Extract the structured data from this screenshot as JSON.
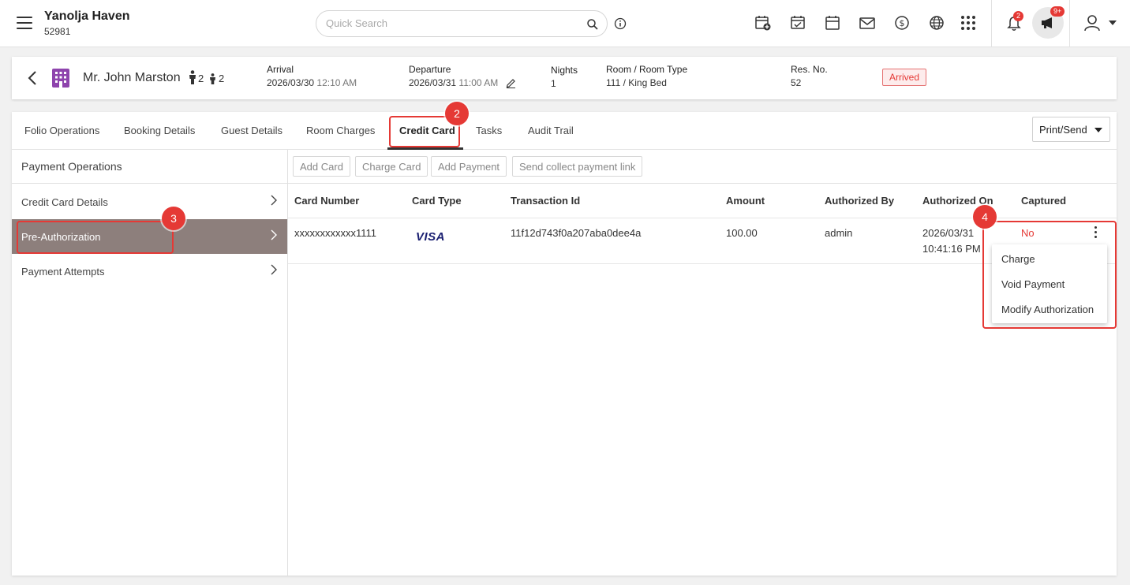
{
  "topbar": {
    "property_name": "Yanolja Haven",
    "property_code": "52981",
    "search_placeholder": "Quick Search",
    "notification_count": "2",
    "announcement_count": "9+",
    "icons": [
      "new-reservation-icon",
      "checklist-icon",
      "calendar-icon",
      "mail-icon",
      "dollar-icon",
      "globe-icon",
      "apps-grid-icon",
      "bell-icon",
      "megaphone-icon",
      "user-icon"
    ]
  },
  "reservation": {
    "guest_name": "Mr. John Marston",
    "adults": "2",
    "children": "2",
    "arrival_label": "Arrival",
    "arrival_date": "2026/03/30",
    "arrival_time": "12:10 AM",
    "departure_label": "Departure",
    "departure_date": "2026/03/31",
    "departure_time": "11:00 AM",
    "nights_label": "Nights",
    "nights": "1",
    "room_label": "Room / Room Type",
    "room_value": "111 / King Bed",
    "resno_label": "Res. No.",
    "resno": "52",
    "status": "Arrived"
  },
  "tabs": [
    "Folio Operations",
    "Booking Details",
    "Guest Details",
    "Room Charges",
    "Credit Card",
    "Tasks",
    "Audit Trail"
  ],
  "active_tab": "Credit Card",
  "print_send_label": "Print/Send",
  "left_nav": {
    "title": "Payment Operations",
    "items": [
      "Credit Card Details",
      "Pre-Authorization",
      "Payment Attempts"
    ],
    "active": "Pre-Authorization"
  },
  "toolbar": {
    "buttons": [
      "Add Card",
      "Charge Card",
      "Add Payment",
      "Send collect payment link"
    ]
  },
  "table": {
    "headers": [
      "Card Number",
      "Card Type",
      "Transaction Id",
      "Amount",
      "Authorized By",
      "Authorized On",
      "Captured"
    ],
    "rows": [
      {
        "card_number": "xxxxxxxxxxxx1111",
        "card_type": "VISA",
        "transaction_id": "11f12d743f0a207aba0dee4a",
        "amount": "100.00",
        "authorized_by": "admin",
        "authorized_on_date": "2026/03/31",
        "authorized_on_time": "10:41:16 PM",
        "captured": "No"
      }
    ]
  },
  "row_menu": {
    "items": [
      "Charge",
      "Void Payment",
      "Modify Authorization"
    ]
  },
  "annotations": [
    "2",
    "3",
    "4"
  ],
  "colors": {
    "accent_red": "#e53935",
    "active_nav_bg": "#8d7f7c",
    "visa_blue": "#1a1f71",
    "building_icon_purple": "#8e44ad"
  }
}
